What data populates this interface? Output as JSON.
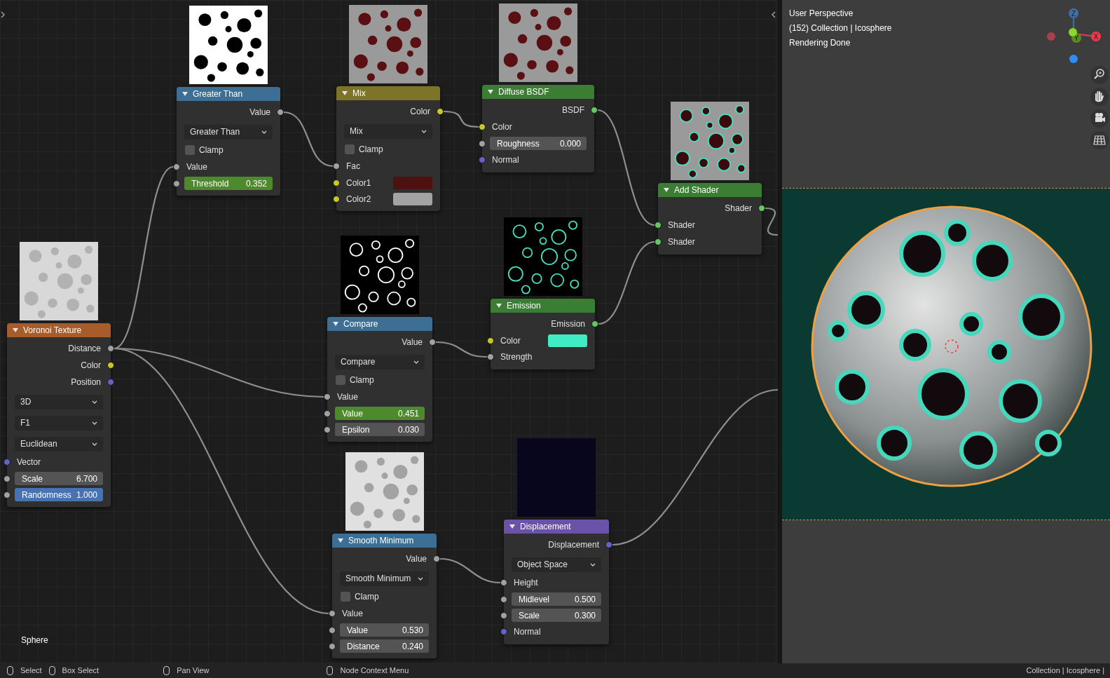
{
  "node_editor": {
    "nodes": [
      {
        "title": "Greater Than",
        "color": "#3c6f93",
        "rows": [
          {
            "kind": "output",
            "label": "Value",
            "socket": {
              "color": "#a1a1a1"
            }
          },
          {
            "kind": "dropdown",
            "value": "Greater Than"
          },
          {
            "kind": "checkbox",
            "label": "Clamp",
            "checked": false
          },
          {
            "kind": "input",
            "label": "Value",
            "socket": {
              "color": "#a1a1a1"
            }
          },
          {
            "kind": "field",
            "label": "Threshold",
            "value": "0.352",
            "color": "#4e8a2c",
            "socket": {
              "color": "#a1a1a1"
            }
          }
        ]
      },
      {
        "title": "Mix",
        "color": "#7d7428",
        "rows": [
          {
            "kind": "output",
            "label": "Color",
            "socket": {
              "color": "#c7c729"
            }
          },
          {
            "kind": "dropdown",
            "value": "Mix"
          },
          {
            "kind": "checkbox",
            "label": "Clamp",
            "checked": false
          },
          {
            "kind": "input",
            "label": "Fac",
            "socket": {
              "color": "#a1a1a1"
            }
          },
          {
            "kind": "color_input",
            "label": "Color1",
            "color": "#4f1010",
            "socket": {
              "color": "#c7c729"
            }
          },
          {
            "kind": "color_input",
            "label": "Color2",
            "color": "#a3a3a3",
            "socket": {
              "color": "#c7c729"
            }
          }
        ]
      },
      {
        "title": "Diffuse BSDF",
        "color": "#3c7d34",
        "rows": [
          {
            "kind": "output",
            "label": "BSDF",
            "socket": {
              "color": "#63c763"
            }
          },
          {
            "kind": "input",
            "label": "Color",
            "socket": {
              "color": "#c7c729"
            }
          },
          {
            "kind": "field",
            "label": "Roughness",
            "value": "0.000",
            "color": "#545454",
            "socket": {
              "color": "#a1a1a1"
            }
          },
          {
            "kind": "input",
            "label": "Normal",
            "socket": {
              "color": "#6363c7"
            }
          }
        ]
      },
      {
        "title": "Add Shader",
        "color": "#3c7d34",
        "rows": [
          {
            "kind": "output",
            "label": "Shader",
            "socket": {
              "color": "#63c763"
            }
          },
          {
            "kind": "input",
            "label": "Shader",
            "socket": {
              "color": "#63c763"
            }
          },
          {
            "kind": "input",
            "label": "Shader",
            "socket": {
              "color": "#63c763"
            }
          }
        ]
      },
      {
        "title": "Voronoi Texture",
        "color": "#a85c2a",
        "rows": [
          {
            "kind": "output",
            "label": "Distance",
            "socket": {
              "color": "#a1a1a1"
            }
          },
          {
            "kind": "output",
            "label": "Color",
            "socket": {
              "color": "#c7c729"
            }
          },
          {
            "kind": "output",
            "label": "Position",
            "socket": {
              "color": "#6363c7"
            }
          },
          {
            "kind": "dropdown",
            "value": "3D"
          },
          {
            "kind": "dropdown",
            "value": "F1"
          },
          {
            "kind": "dropdown",
            "value": "Euclidean"
          },
          {
            "kind": "input",
            "label": "Vector",
            "socket": {
              "color": "#6363c7"
            }
          },
          {
            "kind": "field",
            "label": "Scale",
            "value": "6.700",
            "color": "#545454",
            "socket": {
              "color": "#a1a1a1"
            }
          },
          {
            "kind": "field",
            "label": "Randomness",
            "value": "1.000",
            "color": "#4772b3",
            "socket": {
              "color": "#a1a1a1"
            }
          }
        ]
      },
      {
        "title": "Compare",
        "color": "#3c6f93",
        "rows": [
          {
            "kind": "output",
            "label": "Value",
            "socket": {
              "color": "#a1a1a1"
            }
          },
          {
            "kind": "dropdown",
            "value": "Compare"
          },
          {
            "kind": "checkbox",
            "label": "Clamp",
            "checked": false
          },
          {
            "kind": "input",
            "label": "Value",
            "socket": {
              "color": "#a1a1a1"
            }
          },
          {
            "kind": "field",
            "label": "Value",
            "value": "0.451",
            "color": "#4e8a2c",
            "socket": {
              "color": "#a1a1a1"
            }
          },
          {
            "kind": "field",
            "label": "Epsilon",
            "value": "0.030",
            "color": "#545454",
            "socket": {
              "color": "#a1a1a1"
            }
          }
        ]
      },
      {
        "title": "Emission",
        "color": "#3c7d34",
        "rows": [
          {
            "kind": "output",
            "label": "Emission",
            "socket": {
              "color": "#63c763"
            }
          },
          {
            "kind": "color_input",
            "label": "Color",
            "color": "#40ecc4",
            "socket": {
              "color": "#c7c729"
            }
          },
          {
            "kind": "input",
            "label": "Strength",
            "socket": {
              "color": "#a1a1a1"
            }
          }
        ]
      },
      {
        "title": "Smooth Minimum",
        "color": "#3c6f93",
        "rows": [
          {
            "kind": "output",
            "label": "Value",
            "socket": {
              "color": "#a1a1a1"
            }
          },
          {
            "kind": "dropdown",
            "value": "Smooth Minimum"
          },
          {
            "kind": "checkbox",
            "label": "Clamp",
            "checked": false
          },
          {
            "kind": "input",
            "label": "Value",
            "socket": {
              "color": "#a1a1a1"
            }
          },
          {
            "kind": "field",
            "label": "Value",
            "value": "0.530",
            "color": "#545454",
            "socket": {
              "color": "#a1a1a1"
            }
          },
          {
            "kind": "field",
            "label": "Distance",
            "value": "0.240",
            "color": "#545454",
            "socket": {
              "color": "#a1a1a1"
            }
          }
        ]
      },
      {
        "title": "Displacement",
        "color": "#6a52a8",
        "rows": [
          {
            "kind": "output",
            "label": "Displacement",
            "socket": {
              "color": "#6363c7"
            }
          },
          {
            "kind": "dropdown",
            "value": "Object Space"
          },
          {
            "kind": "input",
            "label": "Height",
            "socket": {
              "color": "#a1a1a1"
            }
          },
          {
            "kind": "field",
            "label": "Midlevel",
            "value": "0.500",
            "color": "#545454",
            "socket": {
              "color": "#a1a1a1"
            }
          },
          {
            "kind": "field",
            "label": "Scale",
            "value": "0.300",
            "color": "#545454",
            "socket": {
              "color": "#a1a1a1"
            }
          },
          {
            "kind": "input",
            "label": "Normal",
            "socket": {
              "color": "#6363c7"
            }
          }
        ]
      }
    ],
    "object_label": "Sphere"
  },
  "viewport": {
    "overlay_lines": [
      "User Perspective",
      "(152) Collection | Icosphere",
      "Rendering Done"
    ],
    "gizmo_axes": [
      "Z",
      "Y",
      "X"
    ]
  },
  "status_bar": {
    "hints": [
      {
        "label": "Select"
      },
      {
        "label": "Box Select"
      },
      {
        "label": "Pan View"
      },
      {
        "label": "Node Context Menu"
      }
    ],
    "right": "Collection | Icosphere |"
  }
}
